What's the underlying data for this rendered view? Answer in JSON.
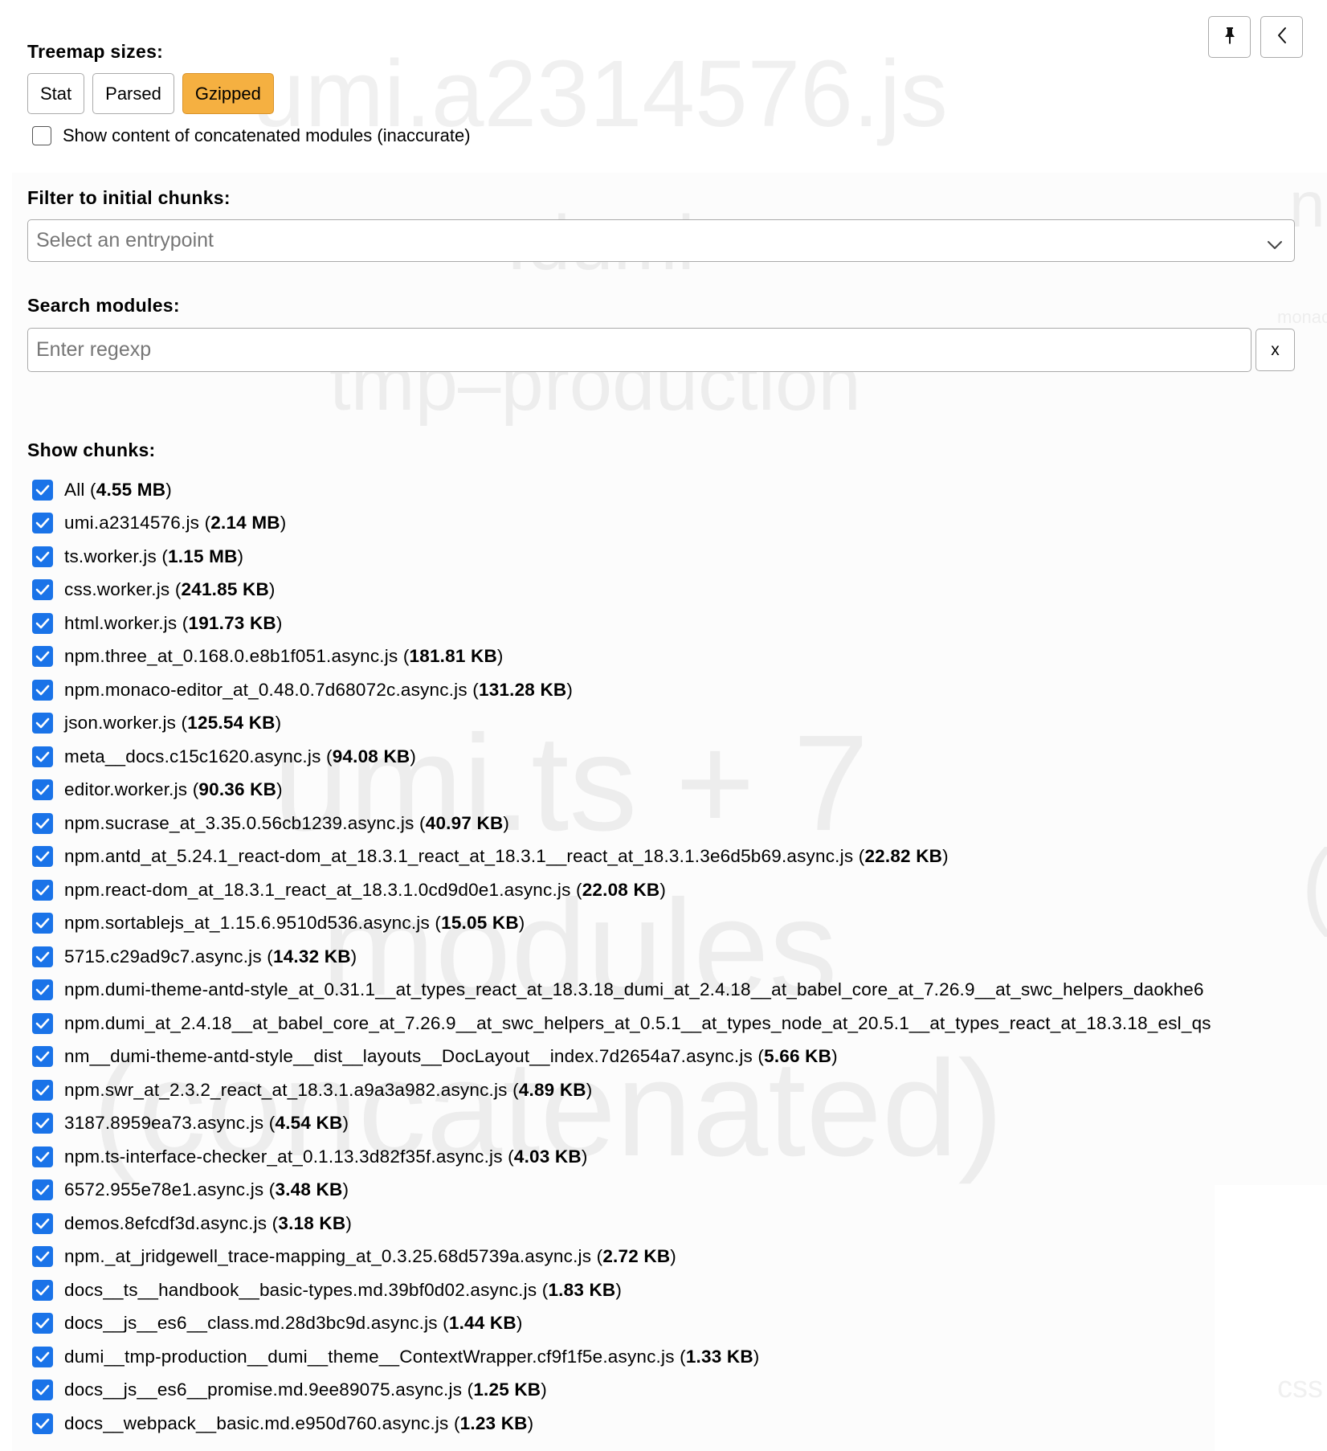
{
  "background_labels": {
    "umi": "umi.a2314576.js",
    "dumi": ".dumi",
    "tmp": "tmp–production",
    "umi_ts": "umi.ts + 7",
    "modules": "modules",
    "concatenated": "(concatenated)",
    "right_n": "n",
    "right_monac": "monac",
    "right_paren": "(",
    "right_css": "css"
  },
  "sidebar": {
    "pin_icon": "pin-icon",
    "close_icon": "chevron-left-icon",
    "treemap_sizes_title": "Treemap sizes:",
    "size_buttons": [
      {
        "label": "Stat",
        "active": false
      },
      {
        "label": "Parsed",
        "active": false
      },
      {
        "label": "Gzipped",
        "active": true
      }
    ],
    "active_color": "#f5b041",
    "concat_label": "Show content of concatenated modules (inaccurate)",
    "concat_checked": false,
    "filter_title": "Filter to initial chunks:",
    "entrypoint_placeholder": "Select an entrypoint",
    "search_title": "Search modules:",
    "search_placeholder": "Enter regexp",
    "search_value": "",
    "clear_label": "x",
    "show_chunks_title": "Show chunks:",
    "checkbox_color": "#1a73e8",
    "chunks": [
      {
        "name": "All",
        "size": "4.55 MB"
      },
      {
        "name": "umi.a2314576.js",
        "size": "2.14 MB"
      },
      {
        "name": "ts.worker.js",
        "size": "1.15 MB"
      },
      {
        "name": "css.worker.js",
        "size": "241.85 KB"
      },
      {
        "name": "html.worker.js",
        "size": "191.73 KB"
      },
      {
        "name": "npm.three_at_0.168.0.e8b1f051.async.js",
        "size": "181.81 KB"
      },
      {
        "name": "npm.monaco-editor_at_0.48.0.7d68072c.async.js",
        "size": "131.28 KB"
      },
      {
        "name": "json.worker.js",
        "size": "125.54 KB"
      },
      {
        "name": "meta__docs.c15c1620.async.js",
        "size": "94.08 KB"
      },
      {
        "name": "editor.worker.js",
        "size": "90.36 KB"
      },
      {
        "name": "npm.sucrase_at_3.35.0.56cb1239.async.js",
        "size": "40.97 KB"
      },
      {
        "name": "npm.antd_at_5.24.1_react-dom_at_18.3.1_react_at_18.3.1__react_at_18.3.1.3e6d5b69.async.js",
        "size": "22.82 KB"
      },
      {
        "name": "npm.react-dom_at_18.3.1_react_at_18.3.1.0cd9d0e1.async.js",
        "size": "22.08 KB"
      },
      {
        "name": "npm.sortablejs_at_1.15.6.9510d536.async.js",
        "size": "15.05 KB"
      },
      {
        "name": "5715.c29ad9c7.async.js",
        "size": "14.32 KB"
      },
      {
        "name": "npm.dumi-theme-antd-style_at_0.31.1__at_types_react_at_18.3.18_dumi_at_2.4.18__at_babel_core_at_7.26.9__at_swc_helpers_daokhe6",
        "size": null
      },
      {
        "name": "npm.dumi_at_2.4.18__at_babel_core_at_7.26.9__at_swc_helpers_at_0.5.1__at_types_node_at_20.5.1__at_types_react_at_18.3.18_esl_qs",
        "size": null
      },
      {
        "name": "nm__dumi-theme-antd-style__dist__layouts__DocLayout__index.7d2654a7.async.js",
        "size": "5.66 KB"
      },
      {
        "name": "npm.swr_at_2.3.2_react_at_18.3.1.a9a3a982.async.js",
        "size": "4.89 KB"
      },
      {
        "name": "3187.8959ea73.async.js",
        "size": "4.54 KB"
      },
      {
        "name": "npm.ts-interface-checker_at_0.1.13.3d82f35f.async.js",
        "size": "4.03 KB"
      },
      {
        "name": "6572.955e78e1.async.js",
        "size": "3.48 KB"
      },
      {
        "name": "demos.8efcdf3d.async.js",
        "size": "3.18 KB"
      },
      {
        "name": "npm._at_jridgewell_trace-mapping_at_0.3.25.68d5739a.async.js",
        "size": "2.72 KB"
      },
      {
        "name": "docs__ts__handbook__basic-types.md.39bf0d02.async.js",
        "size": "1.83 KB"
      },
      {
        "name": "docs__js__es6__class.md.28d3bc9d.async.js",
        "size": "1.44 KB"
      },
      {
        "name": "dumi__tmp-production__dumi__theme__ContextWrapper.cf9f1f5e.async.js",
        "size": "1.33 KB"
      },
      {
        "name": "docs__js__es6__promise.md.9ee89075.async.js",
        "size": "1.25 KB"
      },
      {
        "name": "docs__webpack__basic.md.e950d760.async.js",
        "size": "1.23 KB"
      }
    ]
  }
}
